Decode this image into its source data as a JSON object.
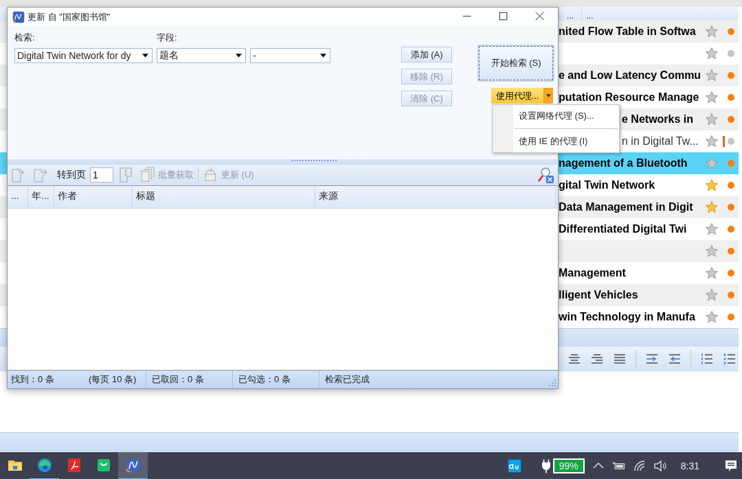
{
  "library": {
    "column_headers": [
      "...",
      "..."
    ],
    "rows": [
      {
        "title": "nited Flow Table in Softwa",
        "bold": true,
        "starred": false,
        "flagged": false,
        "selected": false,
        "color": "#f7800e"
      },
      {
        "starred": false,
        "flagged": false,
        "selected": false,
        "color": "#c4c4c4"
      },
      {
        "title": "e and Low Latency Commu",
        "bold": true,
        "starred": false,
        "flagged": false,
        "selected": false,
        "color": "#f7800e"
      },
      {
        "title": "putation Resource Manage",
        "bold": true,
        "starred": false,
        "flagged": false,
        "selected": false,
        "color": "#f7800e"
      },
      {
        "title": "e Networks in",
        "bold": true,
        "starred": false,
        "flagged": false,
        "selected": false,
        "covered": true,
        "color": "#f7800e"
      },
      {
        "title": "n in Digital Tw...",
        "bold": false,
        "starred": false,
        "flagged": true,
        "selected": false,
        "covered": true,
        "color": "#c4c4c4"
      },
      {
        "title": "nagement of a Bluetooth",
        "bold": true,
        "starred": false,
        "flagged": false,
        "selected": true,
        "color": "#f7800e"
      },
      {
        "title": "gital Twin Network",
        "bold": true,
        "starred": true,
        "flagged": false,
        "selected": false,
        "color": "#f7800e"
      },
      {
        "title": "Data Management in Digit",
        "bold": true,
        "starred": true,
        "flagged": false,
        "selected": false,
        "color": "#f7800e"
      },
      {
        "title": "Differentiated Digital Twi",
        "bold": true,
        "starred": false,
        "flagged": false,
        "selected": false,
        "color": "#f7800e"
      },
      {
        "starred": false,
        "flagged": false,
        "selected": false,
        "color": "#f7800e"
      },
      {
        "title": "Management",
        "bold": true,
        "starred": false,
        "flagged": false,
        "selected": false,
        "color": "#f7800e"
      },
      {
        "title": "lligent Vehicles",
        "bold": true,
        "starred": false,
        "flagged": false,
        "selected": false,
        "color": "#f7800e"
      },
      {
        "title": "win Technology in Manufa",
        "bold": true,
        "starred": false,
        "flagged": false,
        "selected": false,
        "color": "#f7800e"
      }
    ]
  },
  "dialog": {
    "title": "更新 自 \"国家图书馆\"",
    "search_label": "检索:",
    "field_label": "字段:",
    "query": "Digital Twin Network for dy",
    "field": "题名",
    "field_2": "-",
    "buttons": [
      {
        "label": "添加 (A)",
        "disabled": false
      },
      {
        "label": "移除 (R)",
        "disabled": true
      },
      {
        "label": "清除 (C)",
        "disabled": true
      }
    ],
    "search_button": "开始检索 (S)",
    "proxy_button": "使用代理...",
    "proxy_menu": [
      "设置网络代理 (S)...",
      "使用 IE 的代理 (I)"
    ],
    "goto_label": "转到页",
    "page": "1",
    "toolbar": [
      {
        "label": "批量获取",
        "disabled": true
      },
      {
        "label": "更新 (U)",
        "disabled": true
      }
    ],
    "columns": [
      "...",
      "年...",
      "作者",
      "标题",
      "来源"
    ],
    "status": [
      "找到：0 条",
      "(每页 10 条)",
      "已取回：0 条",
      "已勾选：0 条",
      "检索已完成"
    ]
  },
  "taskbar": {
    "apps": [
      {
        "kind": "folder",
        "running": false,
        "selected": false
      },
      {
        "kind": "edge",
        "running": true,
        "selected": false
      },
      {
        "kind": "pdf",
        "running": false,
        "selected": false
      },
      {
        "kind": "bag",
        "running": false,
        "selected": false
      },
      {
        "kind": "ne",
        "running": true,
        "selected": true
      }
    ],
    "battery": "99%",
    "time": "8:31"
  }
}
